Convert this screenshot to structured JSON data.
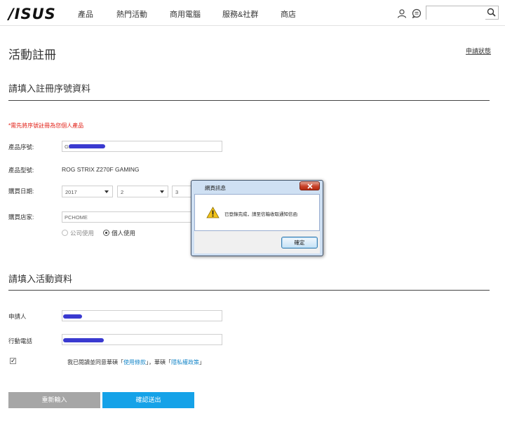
{
  "header": {
    "logo": "/ISUS",
    "nav": [
      "產品",
      "熱門活動",
      "商用電腦",
      "服務&社群",
      "商店"
    ],
    "search_placeholder": ""
  },
  "page": {
    "title": "活動註冊",
    "status_link": "申請狀態"
  },
  "section1": {
    "title": "請填入註冊序號資料",
    "notice": "*需先將序號註冊為您個人產品",
    "serial_label": "產品序號:",
    "serial_value": "GB",
    "model_label": "產品型號:",
    "model_value": "ROG STRIX Z270F GAMING",
    "date_label": "購買日期:",
    "year": "2017",
    "month": "2",
    "day": "3",
    "store_label": "購買店家:",
    "store_value": "PCHOME",
    "radio_company": "公司使用",
    "radio_personal": "個人使用"
  },
  "section2": {
    "title": "請填入活動資料",
    "applicant_label": "申請人",
    "phone_label": "行動電話",
    "agree_prefix": "我已閱讀並同意華碩「",
    "terms_link": "使用條款",
    "agree_middle": "」，華碩「",
    "privacy_link": "隱私權政策",
    "agree_suffix": "」"
  },
  "buttons": {
    "reset": "重新輸入",
    "submit": "確認送出"
  },
  "dialog": {
    "title": "網頁訊息",
    "message": "已登錄完成，請至信箱收取通知信函",
    "ok": "確定"
  },
  "colors": {
    "accent": "#15a2e8",
    "notice_red": "#e2231a",
    "reset_gray": "#a6a6a6",
    "link_blue": "#1a88c9",
    "redaction": "#3a3ad0"
  }
}
